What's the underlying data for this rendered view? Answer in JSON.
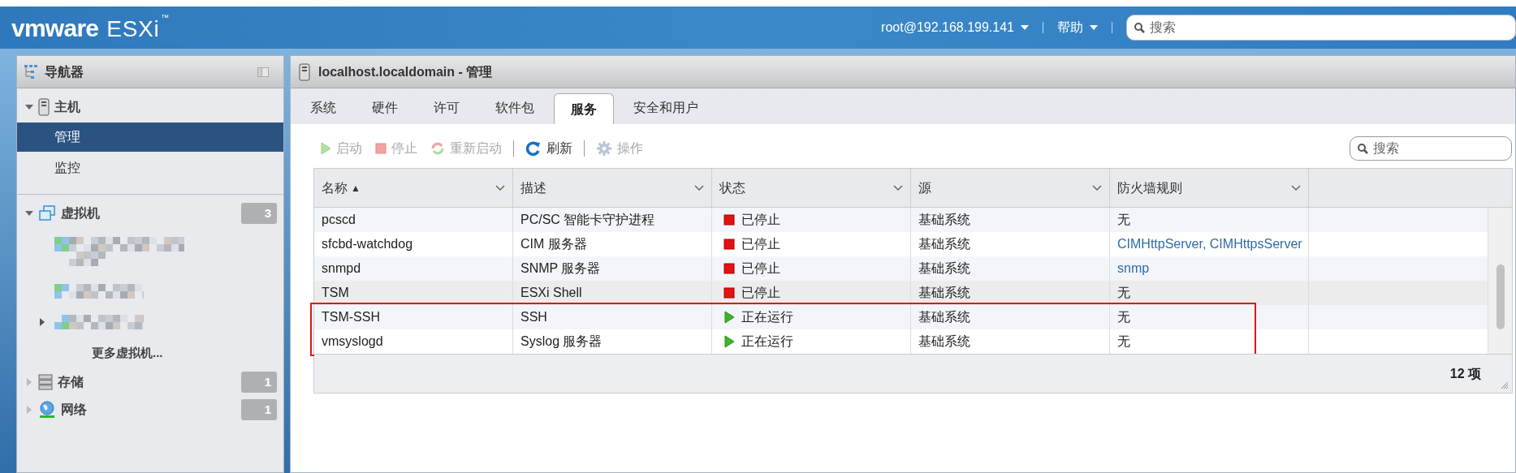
{
  "header": {
    "logo_brand": "vmware",
    "logo_product": "ESXi",
    "logo_mark": "™",
    "user_menu": "root@192.168.199.141",
    "help_menu": "帮助",
    "search": {
      "placeholder": "搜索"
    }
  },
  "navigator": {
    "title": "导航器",
    "sections": [
      {
        "label": "主机",
        "expanded": true,
        "children": [
          {
            "label": "管理",
            "selected": true
          },
          {
            "label": "监控",
            "selected": false
          }
        ]
      },
      {
        "label": "虚拟机",
        "expanded": true,
        "count": "3",
        "vm_entries": [
          {
            "kind": "redacted",
            "expandable": false
          },
          {
            "kind": "redacted",
            "expandable": false
          },
          {
            "kind": "redacted",
            "expandable": true
          }
        ],
        "more": "更多虚拟机..."
      },
      {
        "label": "存储",
        "expanded": false,
        "count": "1"
      },
      {
        "label": "网络",
        "expanded": false,
        "count": "1"
      }
    ]
  },
  "main": {
    "title": "localhost.localdomain - 管理",
    "tabs": [
      {
        "label": "系统",
        "selected": false
      },
      {
        "label": "硬件",
        "selected": false
      },
      {
        "label": "许可",
        "selected": false
      },
      {
        "label": "软件包",
        "selected": false
      },
      {
        "label": "服务",
        "selected": true
      },
      {
        "label": "安全和用户",
        "selected": false
      }
    ],
    "toolbar": [
      {
        "kind": "button",
        "label": "启动",
        "disabled": true
      },
      {
        "kind": "button",
        "label": "停止",
        "disabled": true
      },
      {
        "kind": "button",
        "label": "重新启动",
        "disabled": true
      },
      {
        "kind": "separator"
      },
      {
        "kind": "button",
        "label": "刷新",
        "disabled": false
      },
      {
        "kind": "separator"
      },
      {
        "kind": "button",
        "label": "操作",
        "disabled": true
      }
    ],
    "search": {
      "placeholder": "搜索"
    },
    "table": {
      "columns": [
        {
          "label": "名称",
          "sort": "▲"
        },
        {
          "label": "描述"
        },
        {
          "label": "状态"
        },
        {
          "label": "源"
        },
        {
          "label": "防火墙规则"
        }
      ],
      "rows": [
        {
          "name": "pcscd",
          "description": "PC/SC 智能卡守护进程",
          "status": "已停止",
          "running": false,
          "source": "基础系统",
          "firewall": "无",
          "firewall_link": false,
          "highlighted": false,
          "boxed": false
        },
        {
          "name": "sfcbd-watchdog",
          "description": "CIM 服务器",
          "status": "已停止",
          "running": false,
          "source": "基础系统",
          "firewall": "CIMHttpServer, CIMHttpsServer",
          "firewall_link": true,
          "highlighted": false,
          "boxed": false
        },
        {
          "name": "snmpd",
          "description": "SNMP 服务器",
          "status": "已停止",
          "running": false,
          "source": "基础系统",
          "firewall": "snmp",
          "firewall_link": true,
          "highlighted": false,
          "boxed": false
        },
        {
          "name": "TSM",
          "description": "ESXi Shell",
          "status": "已停止",
          "running": false,
          "source": "基础系统",
          "firewall": "无",
          "firewall_link": false,
          "highlighted": true,
          "boxed": false
        },
        {
          "name": "TSM-SSH",
          "description": "SSH",
          "status": "正在运行",
          "running": true,
          "source": "基础系统",
          "firewall": "无",
          "firewall_link": false,
          "highlighted": false,
          "boxed": true
        },
        {
          "name": "vmsyslogd",
          "description": "Syslog 服务器",
          "status": "正在运行",
          "running": true,
          "source": "基础系统",
          "firewall": "无",
          "firewall_link": false,
          "highlighted": false,
          "boxed": true
        }
      ],
      "footer": "12 项"
    }
  }
}
